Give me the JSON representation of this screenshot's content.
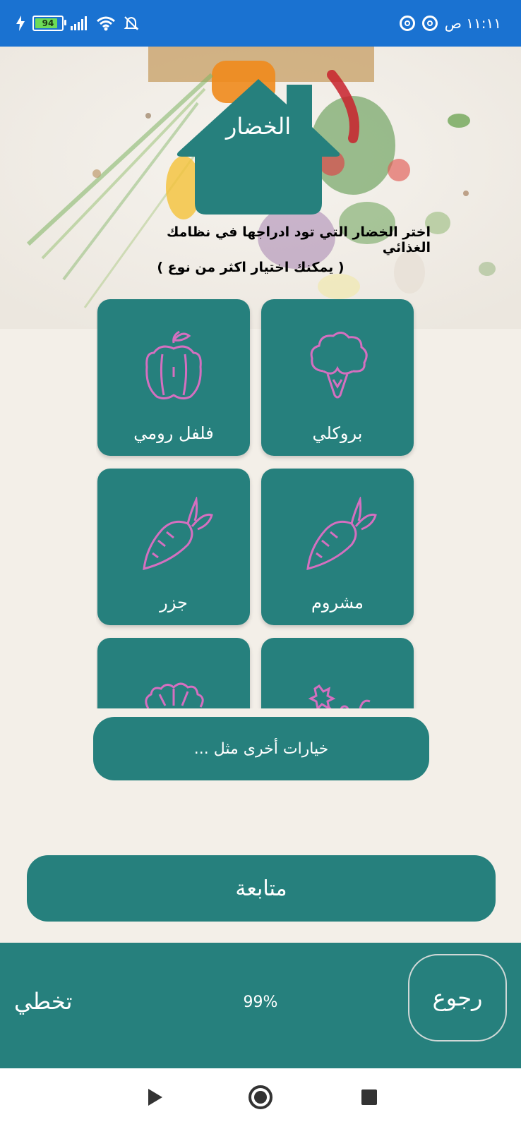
{
  "status_bar": {
    "battery_level": "94",
    "time": "١١:١١ ص"
  },
  "header": {
    "title": "الخضار"
  },
  "instructions": {
    "main": "اختر الخضار التي تود ادراجها في نظامك الغذائي",
    "sub": "( يمكنك اختيار اكثر من نوع )"
  },
  "vegetables": [
    {
      "label": "بروكلي",
      "icon": "broccoli-icon"
    },
    {
      "label": "فلفل رومي",
      "icon": "bell-pepper-icon"
    },
    {
      "label": "مشروم",
      "icon": "carrot-icon"
    },
    {
      "label": "جزر",
      "icon": "carrot-icon"
    },
    {
      "label": "",
      "icon": "vine-icon"
    },
    {
      "label": "",
      "icon": "lettuce-icon"
    }
  ],
  "other_options": {
    "label": "خيارات أخرى مثل ..."
  },
  "continue_button": {
    "label": "متابعة"
  },
  "bottom_bar": {
    "skip_label": "تخطي",
    "progress_text": "99%",
    "back_label": "رجوع"
  },
  "colors": {
    "primary": "#26807d",
    "status_bar": "#1a72d1",
    "icon_stroke": "#d56fc0"
  }
}
